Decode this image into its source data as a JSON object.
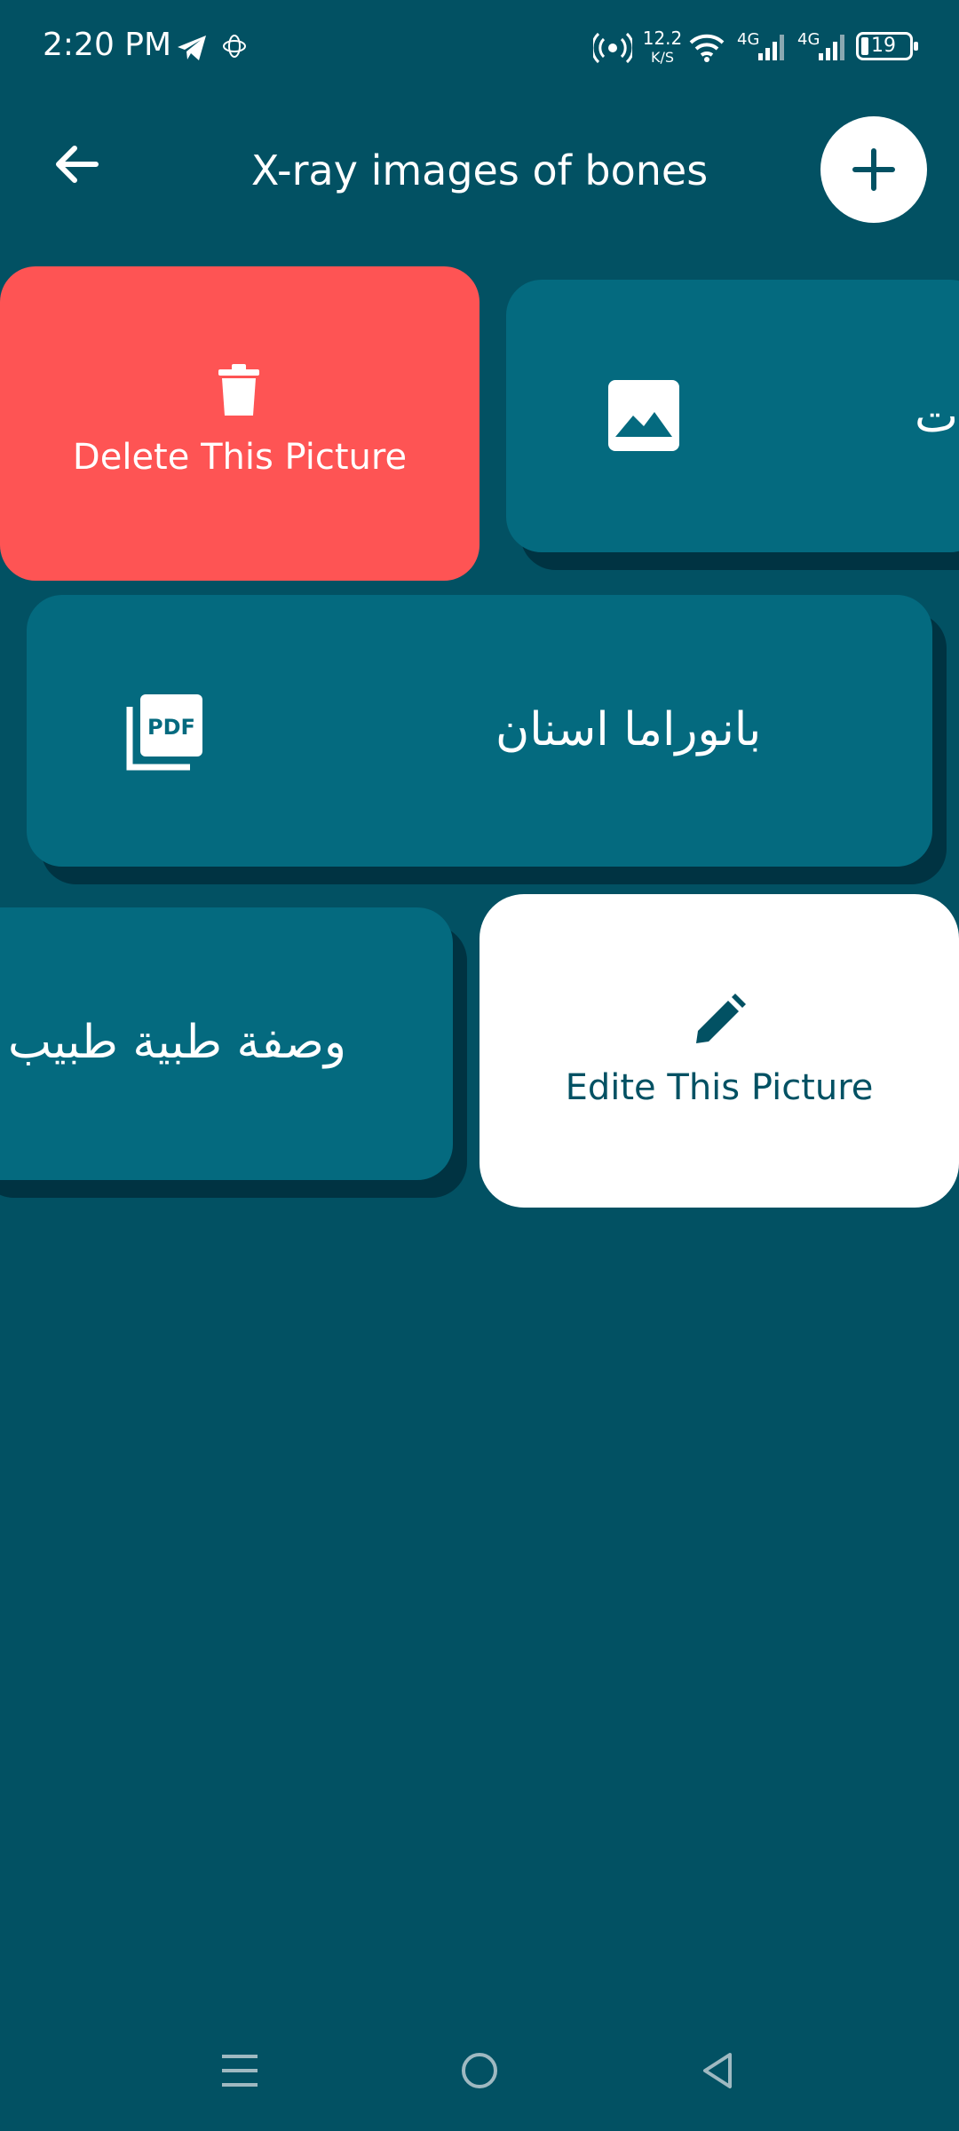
{
  "status_bar": {
    "time": "2:20 PM",
    "network_speed_value": "12.2",
    "network_speed_unit": "K/S",
    "sim1_label": "4G",
    "sim2_label": "4G",
    "battery": "19"
  },
  "app_bar": {
    "title": "X-ray images of bones"
  },
  "action_cards": {
    "delete_label": "Delete This Picture",
    "edit_label": "Edite This Picture"
  },
  "file_items": [
    {
      "label": "ات",
      "icon": "image-icon"
    },
    {
      "label": "بانوراما اسنان",
      "icon": "pdf-icon"
    },
    {
      "label": "وصفة طبية طبيب ج",
      "icon": "none"
    }
  ],
  "colors": {
    "background": "#025163",
    "card": "#046a7f",
    "delete": "#fe5454",
    "edit_text": "#025163"
  }
}
